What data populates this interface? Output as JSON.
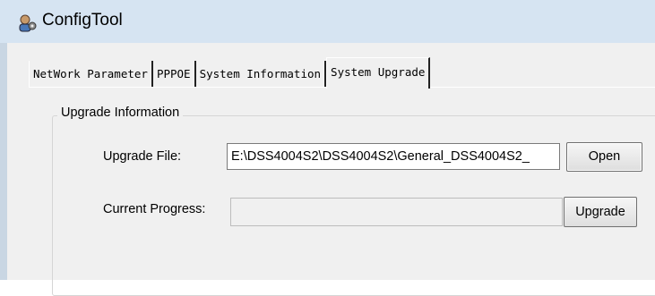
{
  "window": {
    "title": "ConfigTool",
    "icon": "config-tool-icon"
  },
  "tabs": [
    {
      "label": "NetWork Parameter",
      "active": false
    },
    {
      "label": "PPPOE",
      "active": false
    },
    {
      "label": "System Information",
      "active": false
    },
    {
      "label": "System Upgrade",
      "active": true
    }
  ],
  "upgrade": {
    "group_label": "Upgrade Information",
    "file_label": "Upgrade File:",
    "file_value": "E:\\DSS4004S2\\DSS4004S2\\General_DSS4004S2_",
    "open_label": "Open",
    "progress_label": "Current Progress:",
    "progress_fraction": 0,
    "upgrade_label": "Upgrade"
  },
  "colors": {
    "titlebar": "#d6e4f2",
    "client": "#f0f0f0",
    "progress_fill": "#06b025"
  }
}
